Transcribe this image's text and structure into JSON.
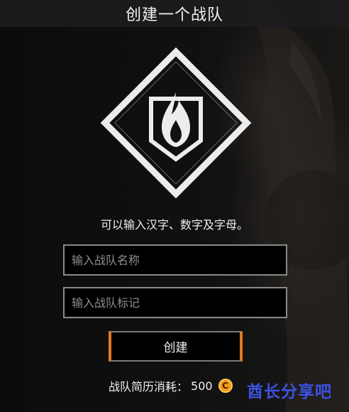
{
  "header": {
    "title": "创建一个战队"
  },
  "emblem": {
    "icon": "flame-shield-icon"
  },
  "form": {
    "hint": "可以输入汉字、数字及字母。",
    "name_placeholder": "输入战队名称",
    "tag_placeholder": "输入战队标记",
    "create_label": "创建",
    "cost_label": "战队简历消耗：",
    "cost_value": "500",
    "coin_glyph": "C"
  },
  "watermark": {
    "text": "酋长分享吧"
  },
  "colors": {
    "accent": "#e07a1f",
    "coin": "#f39a1b",
    "watermark": "#3d52e0"
  }
}
